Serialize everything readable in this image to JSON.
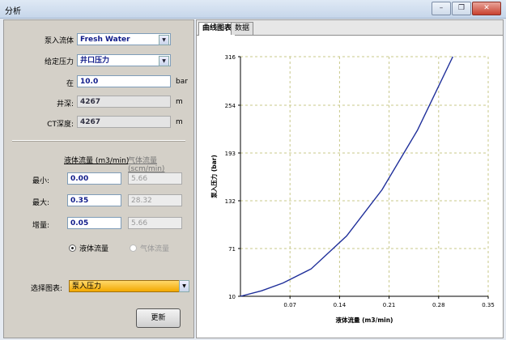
{
  "window": {
    "title": "分析",
    "minimize": "–",
    "restore": "❐",
    "close": "✕"
  },
  "form": {
    "fluid_label": "泵入流体",
    "fluid_value": "Fresh Water",
    "given_label": "给定压力",
    "given_value": "井口压力",
    "at_label": "在",
    "at_value": "10.0",
    "at_unit": "bar",
    "depth_label": "井深:",
    "depth_value": "4267",
    "depth_unit": "m",
    "ct_label": "CT深度:",
    "ct_value": "4267",
    "ct_unit": "m",
    "liquid_header": "液体流量 (m3/min)",
    "gas_header": "气体流量 (scm/min)",
    "rows": [
      {
        "label": "最小:",
        "liquid": "0.00",
        "gas": "5.66"
      },
      {
        "label": "最大:",
        "liquid": "0.35",
        "gas": "28.32"
      },
      {
        "label": "增量:",
        "liquid": "0.05",
        "gas": "5.66"
      }
    ],
    "radio_liquid": "液体流量",
    "radio_gas": "气体流量",
    "chart_select_label": "选择图表:",
    "chart_select_value": "泵入压力",
    "update_button": "更新"
  },
  "tabs": [
    {
      "label": "曲线图表"
    },
    {
      "label": "数据"
    }
  ],
  "chart_data": {
    "type": "line",
    "xlabel": "液体流量 (m3/min)",
    "ylabel": "泵入压力 (bar)",
    "xlim": [
      0,
      0.35
    ],
    "ylim": [
      10,
      316
    ],
    "xticks": [
      "0.07",
      "0.14",
      "0.21",
      "0.28",
      "0.35"
    ],
    "yticks": [
      "10",
      "71",
      "132",
      "193",
      "254",
      "316"
    ],
    "grid": true,
    "series": [
      {
        "color": "#1f2f9a",
        "x": [
          0.0,
          0.03,
          0.06,
          0.1,
          0.15,
          0.2,
          0.25,
          0.3
        ],
        "y": [
          10,
          17,
          27,
          45,
          87,
          146,
          222,
          316
        ]
      }
    ]
  }
}
